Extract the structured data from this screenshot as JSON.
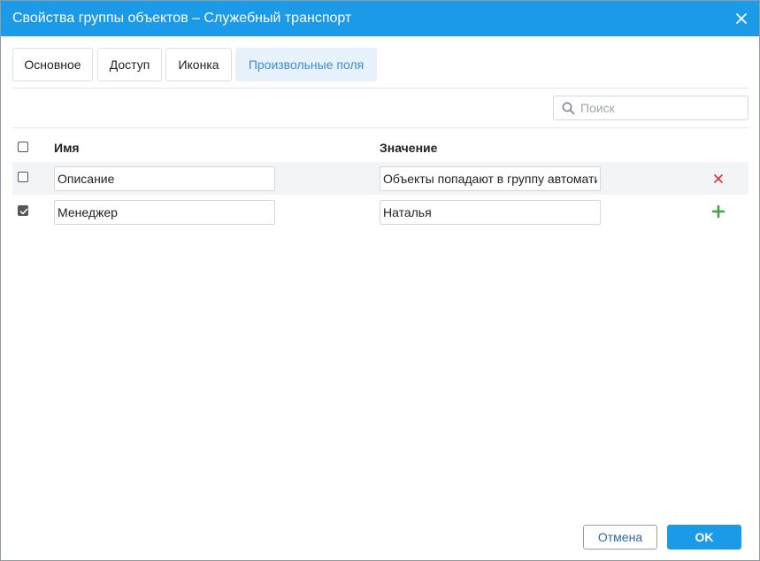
{
  "dialog": {
    "title": "Свойства группы объектов – Служебный транспорт"
  },
  "tabs": [
    {
      "label": "Основное",
      "active": false
    },
    {
      "label": "Доступ",
      "active": false
    },
    {
      "label": "Иконка",
      "active": false
    },
    {
      "label": "Произвольные поля",
      "active": true
    }
  ],
  "search": {
    "placeholder": "Поиск",
    "value": ""
  },
  "table": {
    "columns": {
      "name": "Имя",
      "value": "Значение"
    },
    "select_all_checked": false,
    "rows": [
      {
        "checked": false,
        "name": "Описание",
        "value": "Объекты попадают в группу автоматически",
        "action": "delete-icon"
      },
      {
        "checked": true,
        "name": "Менеджер",
        "value": "Наталья",
        "action": "plus-icon"
      }
    ]
  },
  "footer": {
    "cancel_label": "Отмена",
    "ok_label": "OK"
  },
  "colors": {
    "titlebar": "#1b9ae8",
    "active_tab_bg": "#e8f2fc",
    "active_tab_text": "#3c8bd9",
    "delete": "#e53935",
    "add": "#43a047"
  }
}
